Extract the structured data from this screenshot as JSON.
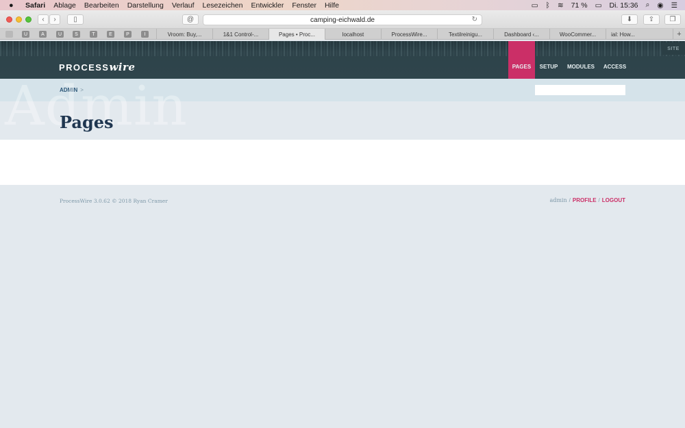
{
  "menubar": {
    "apple": "",
    "items": [
      "Safari",
      "Ablage",
      "Bearbeiten",
      "Darstellung",
      "Verlauf",
      "Lesezeichen",
      "Entwickler",
      "Fenster",
      "Hilfe"
    ],
    "battery": "71 %",
    "clock": "Di. 15:36"
  },
  "browser": {
    "url": "camping-eichwald.de",
    "pinned_tabs": [
      "U",
      "A",
      "U",
      "S",
      "T",
      "E",
      "P",
      "I"
    ],
    "tabs": [
      "Vroom: Buy,...",
      "1&1 Control-...",
      "Pages • Proc...",
      "localhost",
      "ProcessWire...",
      "Textilreinigu...",
      "Dashboard ‹...",
      "WooCommer...",
      "ial: How..."
    ],
    "active_tab_index": 2
  },
  "admin": {
    "site_label": "SITE",
    "logo_process": "PROCESS",
    "logo_wire": "wire",
    "nav": [
      "PAGES",
      "SETUP",
      "MODULES",
      "ACCESS"
    ],
    "active_nav": "PAGES",
    "breadcrumb": "ADMIN",
    "breadcrumb_sep": ">",
    "watermark": "Admin",
    "page_title": "Pages",
    "search_placeholder": ""
  },
  "footer": {
    "copyright": "ProcessWire 3.0.62 © 2018 Ryan Cramer",
    "user": "admin",
    "profile": "PROFILE",
    "logout": "LOGOUT"
  },
  "colors": {
    "accent": "#cb2f67",
    "masthead": "#2f454c",
    "breadcrumb_bg": "#d5e3ea",
    "page_bg": "#e3e9ee"
  }
}
